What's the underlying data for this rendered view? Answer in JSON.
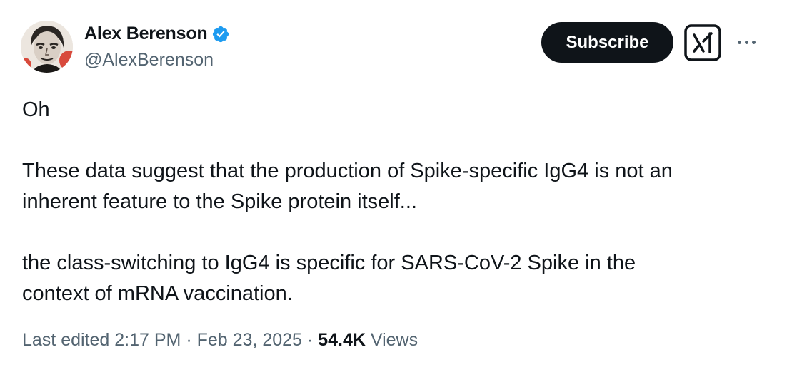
{
  "author": {
    "name": "Alex Berenson",
    "handle": "@AlexBerenson",
    "verified": true,
    "verified_color": "#1d9bf0"
  },
  "header": {
    "subscribe_label": "Subscribe",
    "grok_icon": "grok-icon",
    "more_icon": "more-options-icon"
  },
  "tweet": {
    "line1": "Oh",
    "paragraph2_line1": "These data suggest that the production of Spike-specific IgG4 is not an",
    "paragraph2_line2": "inherent feature to the Spike protein itself...",
    "paragraph3_line1": "the class-switching to IgG4 is specific for SARS-CoV-2 Spike in the",
    "paragraph3_line2": "context of mRNA vaccination."
  },
  "meta": {
    "edited_label": "Last edited 2:17 PM",
    "separator": "·",
    "date": "Feb 23, 2025",
    "views_count": "54.4K",
    "views_label": "Views"
  },
  "colors": {
    "text": "#0f1419",
    "secondary": "#536471",
    "button_bg": "#0f1419"
  }
}
